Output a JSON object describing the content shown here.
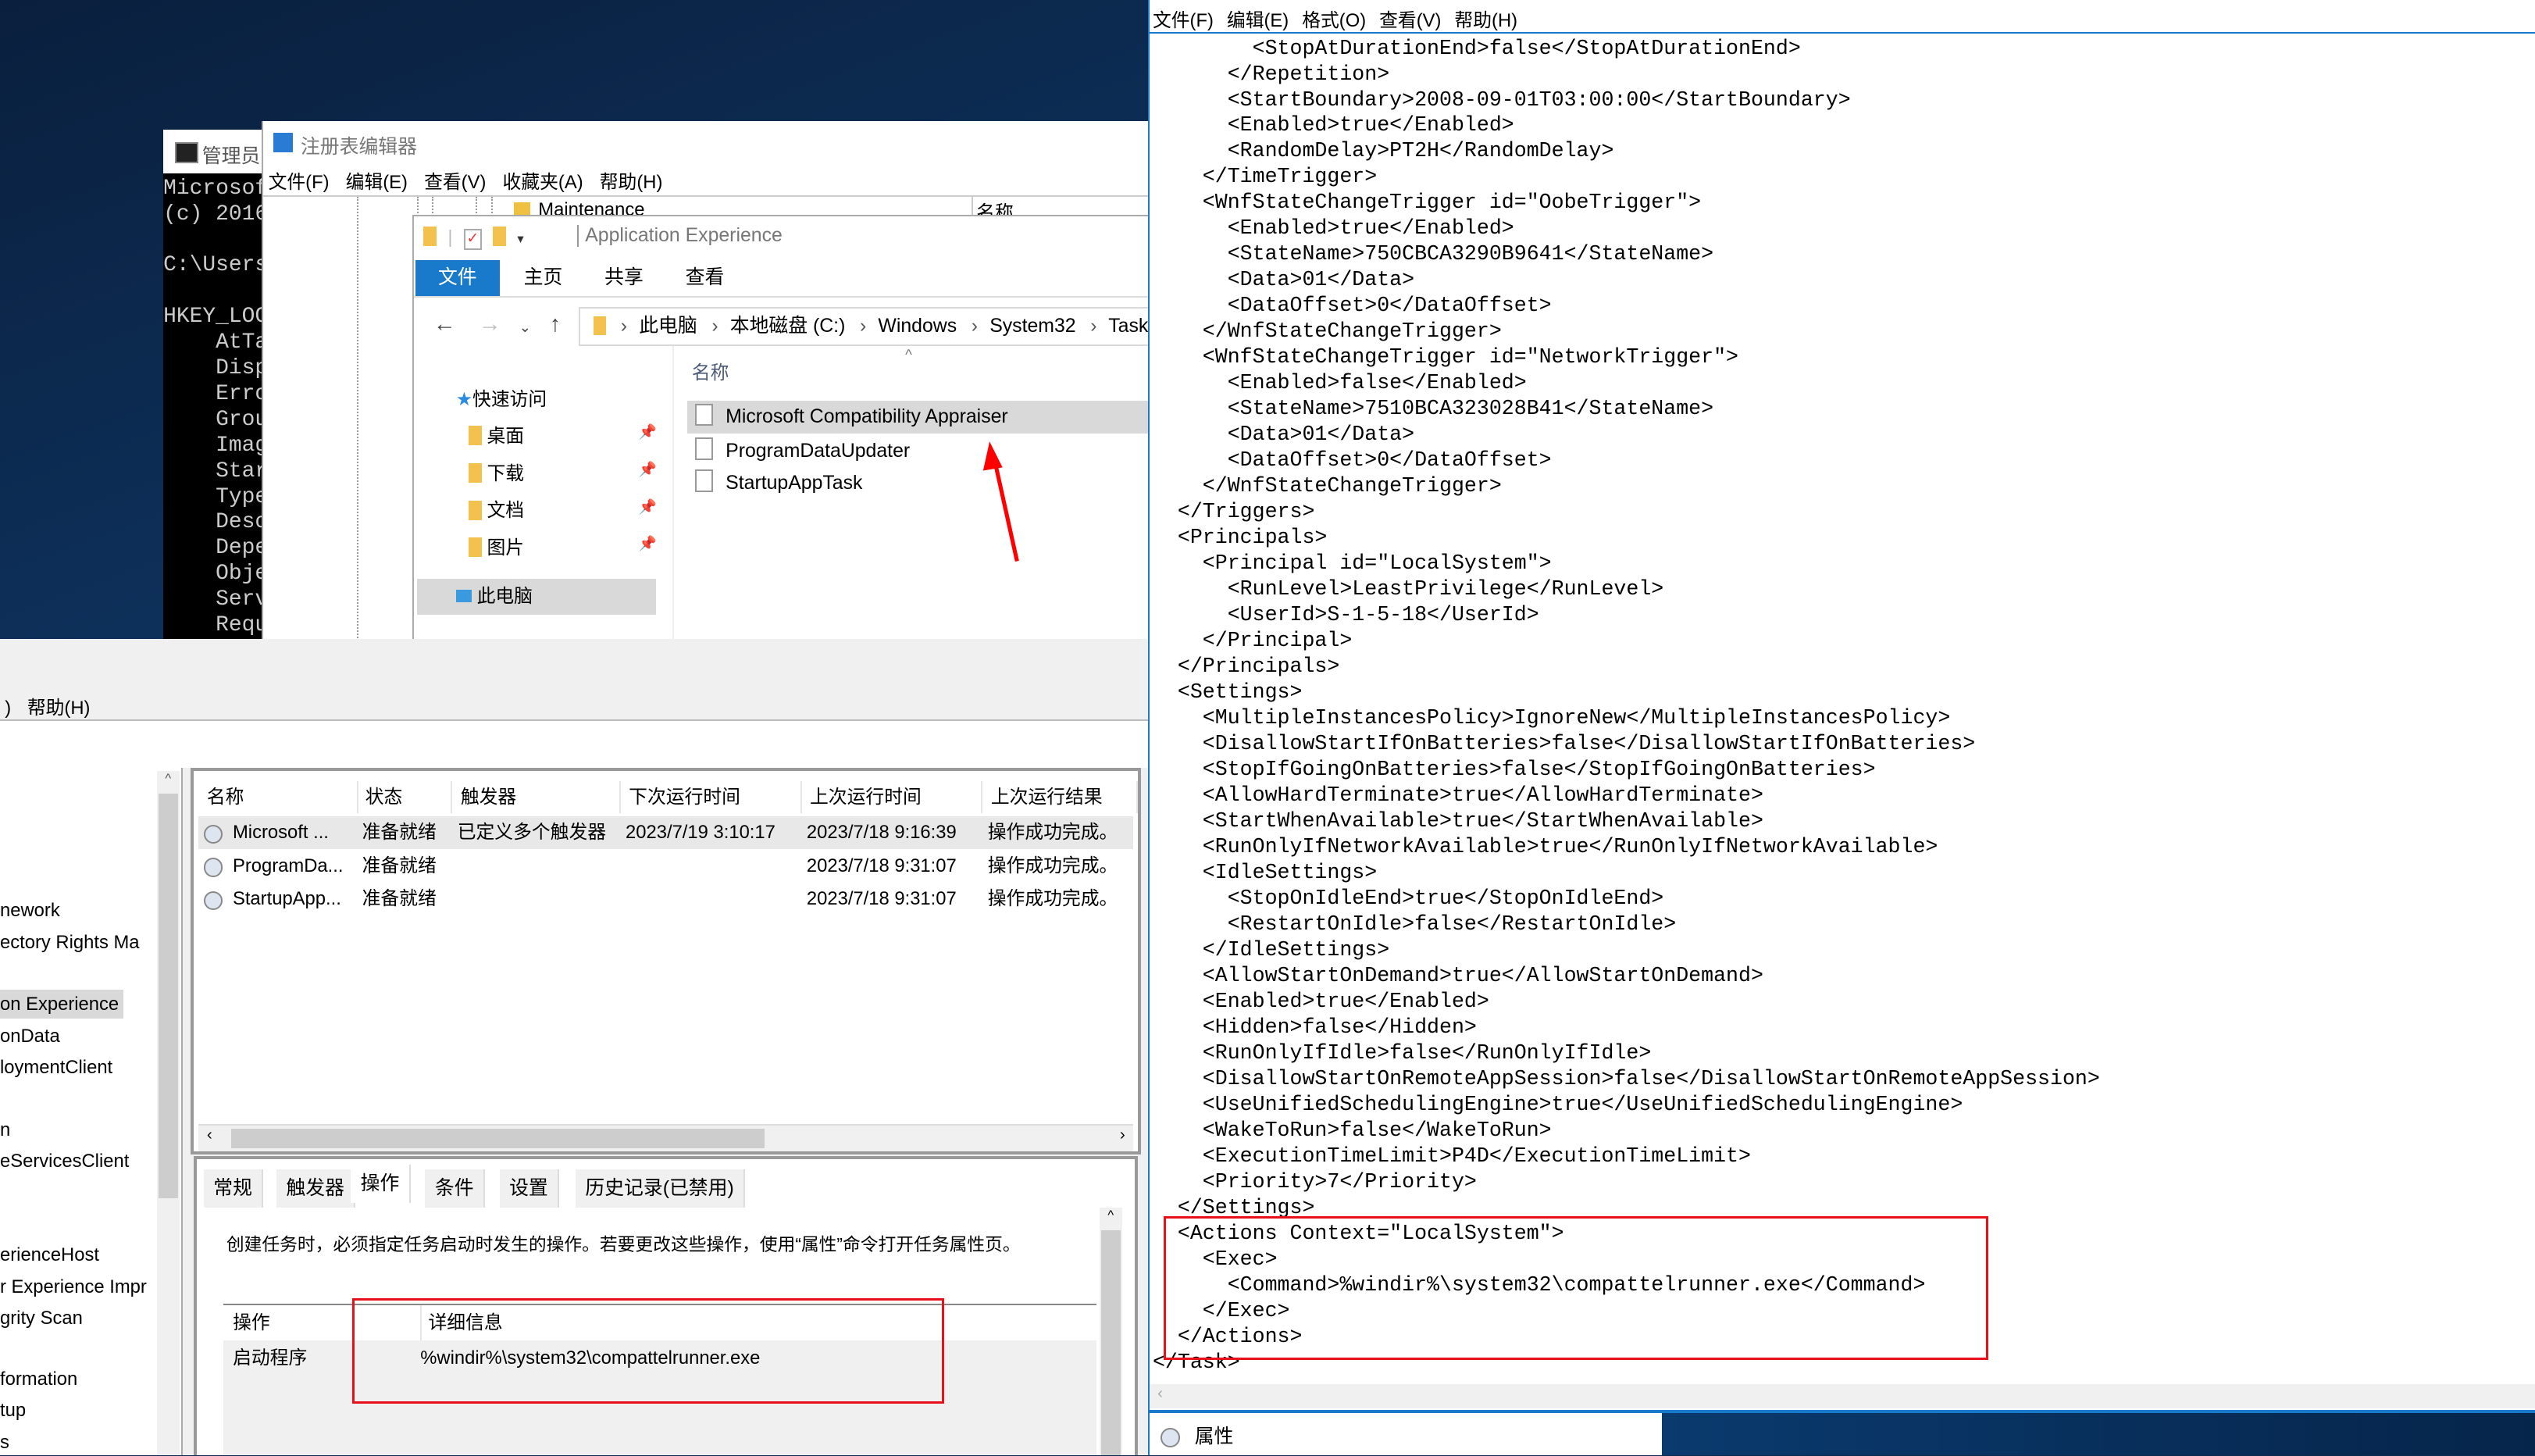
{
  "cmd": {
    "title": "管理员",
    "lines": [
      "Microsof",
      "(c) 2016",
      "",
      "C:\\Users",
      "",
      "HKEY_LOC",
      "    AtTa",
      "    Disp",
      "    Erro",
      "    Grou",
      "    Imag",
      "    Star",
      "    Type",
      "    Desc",
      "    Depe",
      "    Obje",
      "    Serv",
      "    Requ"
    ]
  },
  "regedit": {
    "title": "注册表编辑器",
    "menu": [
      "文件(F)",
      "编辑(E)",
      "查看(V)",
      "收藏夹(A)",
      "帮助(H)"
    ],
    "tree_item": "Maintenance",
    "column": "名称"
  },
  "explorer": {
    "title": "Application Experience",
    "ribbon_tabs": [
      "文件",
      "主页",
      "共享",
      "查看"
    ],
    "path": [
      "此电脑",
      "本地磁盘 (C:)",
      "Windows",
      "System32",
      "Tasks"
    ],
    "nav": {
      "quick_access": "快速访问",
      "items": [
        "桌面",
        "下载",
        "文档",
        "图片"
      ],
      "this_pc": "此电脑"
    },
    "column_name": "名称",
    "files": [
      "Microsoft Compatibility Appraiser",
      "ProgramDataUpdater",
      "StartupAppTask"
    ],
    "selected_file": "Microsoft Compatibility Appraiser"
  },
  "scheduler": {
    "menu_help": "帮助(H)",
    "tree": [
      {
        "label": "nework"
      },
      {
        "label": "ectory Rights Ma"
      },
      {
        "label": "on Experience",
        "selected": true
      },
      {
        "label": "onData"
      },
      {
        "label": "loymentClient"
      },
      {
        "label": "n"
      },
      {
        "label": "eServicesClient"
      },
      {
        "label": "erienceHost"
      },
      {
        "label": "r Experience Impr"
      },
      {
        "label": "grity Scan"
      },
      {
        "label": "formation"
      },
      {
        "label": "tup"
      },
      {
        "label": "s"
      }
    ],
    "columns": [
      "名称",
      "状态",
      "触发器",
      "下次运行时间",
      "上次运行时间",
      "上次运行结果"
    ],
    "rows": [
      [
        "Microsoft ...",
        "准备就绪",
        "已定义多个触发器",
        "2023/7/19 3:10:17",
        "2023/7/18 9:16:39",
        "操作成功完成。"
      ],
      [
        "ProgramDa...",
        "准备就绪",
        "",
        "",
        "2023/7/18 9:31:07",
        "操作成功完成。"
      ],
      [
        "StartupApp...",
        "准备就绪",
        "",
        "",
        "2023/7/18 9:31:07",
        "操作成功完成。"
      ]
    ],
    "tabs": [
      "常规",
      "触发器",
      "操作",
      "条件",
      "设置",
      "历史记录(已禁用)"
    ],
    "active_tab": "操作",
    "description": "创建任务时，必须指定任务启动时发生的操作。若要更改这些操作，使用“属性”命令打开任务属性页。",
    "action_columns": [
      "操作",
      "详细信息"
    ],
    "action_row": [
      "启动程序",
      "%windir%\\system32\\compattelrunner.exe"
    ]
  },
  "notepad": {
    "menu": [
      "文件(F)",
      "编辑(E)",
      "格式(O)",
      "查看(V)",
      "帮助(H)"
    ],
    "lines": [
      "        <StopAtDurationEnd>false</StopAtDurationEnd>",
      "      </Repetition>",
      "      <StartBoundary>2008-09-01T03:00:00</StartBoundary>",
      "      <Enabled>true</Enabled>",
      "      <RandomDelay>PT2H</RandomDelay>",
      "    </TimeTrigger>",
      "    <WnfStateChangeTrigger id=\"OobeTrigger\">",
      "      <Enabled>true</Enabled>",
      "      <StateName>750CBCA3290B9641</StateName>",
      "      <Data>01</Data>",
      "      <DataOffset>0</DataOffset>",
      "    </WnfStateChangeTrigger>",
      "    <WnfStateChangeTrigger id=\"NetworkTrigger\">",
      "      <Enabled>false</Enabled>",
      "      <StateName>7510BCA323028B41</StateName>",
      "      <Data>01</Data>",
      "      <DataOffset>0</DataOffset>",
      "    </WnfStateChangeTrigger>",
      "  </Triggers>",
      "  <Principals>",
      "    <Principal id=\"LocalSystem\">",
      "      <RunLevel>LeastPrivilege</RunLevel>",
      "      <UserId>S-1-5-18</UserId>",
      "    </Principal>",
      "  </Principals>",
      "  <Settings>",
      "    <MultipleInstancesPolicy>IgnoreNew</MultipleInstancesPolicy>",
      "    <DisallowStartIfOnBatteries>false</DisallowStartIfOnBatteries>",
      "    <StopIfGoingOnBatteries>false</StopIfGoingOnBatteries>",
      "    <AllowHardTerminate>true</AllowHardTerminate>",
      "    <StartWhenAvailable>true</StartWhenAvailable>",
      "    <RunOnlyIfNetworkAvailable>true</RunOnlyIfNetworkAvailable>",
      "    <IdleSettings>",
      "      <StopOnIdleEnd>true</StopOnIdleEnd>",
      "      <RestartOnIdle>false</RestartOnIdle>",
      "    </IdleSettings>",
      "    <AllowStartOnDemand>true</AllowStartOnDemand>",
      "    <Enabled>true</Enabled>",
      "    <Hidden>false</Hidden>",
      "    <RunOnlyIfIdle>false</RunOnlyIfIdle>",
      "    <DisallowStartOnRemoteAppSession>false</DisallowStartOnRemoteAppSession>",
      "    <UseUnifiedSchedulingEngine>true</UseUnifiedSchedulingEngine>",
      "    <WakeToRun>false</WakeToRun>",
      "    <ExecutionTimeLimit>P4D</ExecutionTimeLimit>",
      "    <Priority>7</Priority>",
      "  </Settings>",
      "  <Actions Context=\"LocalSystem\">",
      "    <Exec>",
      "      <Command>%windir%\\system32\\compattelrunner.exe</Command>",
      "    </Exec>",
      "  </Actions>",
      "</Task>"
    ],
    "properties_label": "属性"
  },
  "colors": {
    "accent": "#1979ca",
    "highlight_red": "#e8101a",
    "arrow_red": "#ff0000"
  }
}
